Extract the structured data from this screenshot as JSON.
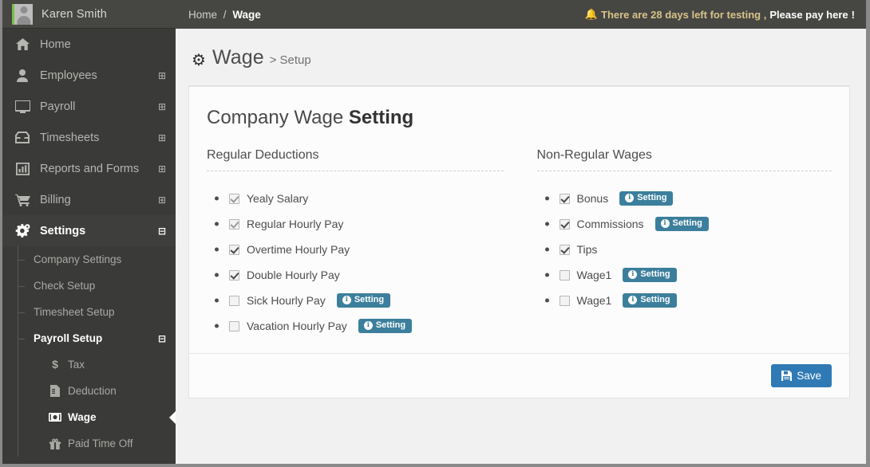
{
  "sidebar": {
    "user": {
      "name": "Karen Smith",
      "avatar_icon": "user-avatar-icon"
    },
    "items": [
      {
        "label": "Home",
        "icon": "home-icon",
        "expander": ""
      },
      {
        "label": "Employees",
        "icon": "user-icon",
        "expander": "⊞"
      },
      {
        "label": "Payroll",
        "icon": "desktop-icon",
        "expander": "⊞"
      },
      {
        "label": "Timesheets",
        "icon": "inbox-icon",
        "expander": "⊞"
      },
      {
        "label": "Reports and Forms",
        "icon": "bar-chart-icon",
        "expander": "⊞"
      },
      {
        "label": "Billing",
        "icon": "shopping-cart-icon",
        "expander": "⊞"
      },
      {
        "label": "Settings",
        "icon": "gears-icon",
        "expander": "⊟"
      }
    ],
    "settings_children": [
      {
        "label": "Company Settings",
        "expander": ""
      },
      {
        "label": "Check Setup",
        "expander": ""
      },
      {
        "label": "Timesheet Setup",
        "expander": ""
      },
      {
        "label": "Payroll Setup",
        "expander": "⊟"
      }
    ],
    "payroll_setup_children": [
      {
        "label": "Tax",
        "icon": "dollar-icon"
      },
      {
        "label": "Deduction",
        "icon": "file-text-icon"
      },
      {
        "label": "Wage",
        "icon": "money-bill-icon"
      },
      {
        "label": "Paid Time Off",
        "icon": "gift-icon"
      }
    ]
  },
  "topbar": {
    "breadcrumb_home": "Home",
    "breadcrumb_sep": "/",
    "breadcrumb_current": "Wage",
    "notice_bell_icon": "bell-icon",
    "notice_text": "There are 28 days left for testing ,",
    "notice_pay": "Please pay here",
    "notice_bang": "!"
  },
  "page": {
    "gear_icon": "gear-icon",
    "title": "Wage",
    "separator": ">",
    "subtitle": "Setup"
  },
  "card": {
    "title_light": "Company Wage",
    "title_bold": "Setting",
    "left_column": {
      "heading": "Regular Deductions",
      "options": [
        {
          "label": "Yealy Salary",
          "checked": true,
          "has_setting": false,
          "setting_label": ""
        },
        {
          "label": "Regular Hourly Pay",
          "checked": true,
          "has_setting": false,
          "setting_label": ""
        },
        {
          "label": "Overtime Hourly Pay",
          "checked": true,
          "has_setting": false,
          "setting_label": ""
        },
        {
          "label": "Double Hourly Pay",
          "checked": true,
          "has_setting": false,
          "setting_label": ""
        },
        {
          "label": "Sick Hourly Pay",
          "checked": false,
          "has_setting": true,
          "setting_label": "Setting"
        },
        {
          "label": "Vacation Hourly Pay",
          "checked": false,
          "has_setting": true,
          "setting_label": "Setting"
        }
      ]
    },
    "right_column": {
      "heading": "Non-Regular Wages",
      "options": [
        {
          "label": "Bonus",
          "checked": true,
          "has_setting": true,
          "setting_label": "Setting"
        },
        {
          "label": "Commissions",
          "checked": true,
          "has_setting": true,
          "setting_label": "Setting"
        },
        {
          "label": "Tips",
          "checked": true,
          "has_setting": false,
          "setting_label": ""
        },
        {
          "label": "Wage1",
          "checked": false,
          "has_setting": true,
          "setting_label": "Setting"
        },
        {
          "label": "Wage1",
          "checked": false,
          "has_setting": true,
          "setting_label": "Setting"
        }
      ]
    },
    "save_label": "Save",
    "save_icon": "floppy-disk-icon"
  },
  "colors": {
    "sidebar_bg": "#3a3a38",
    "topbar_bg": "#464643",
    "accent_save": "#2f7ab5",
    "accent_setting": "#3c7f9c",
    "notice": "#d9c38a",
    "avatar_accent": "#7ac143"
  }
}
